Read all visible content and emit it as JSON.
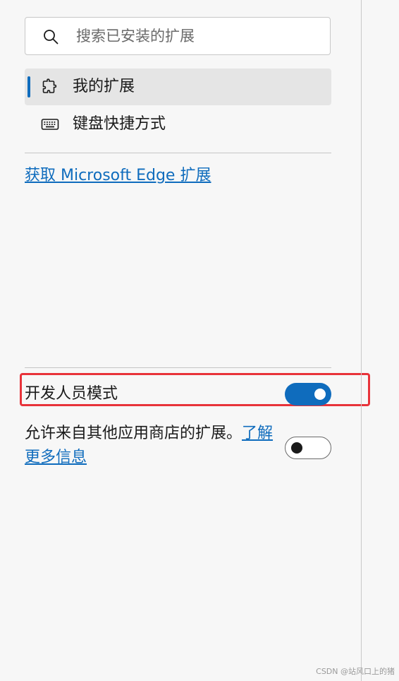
{
  "search": {
    "placeholder": "搜索已安装的扩展",
    "icon": "search-icon"
  },
  "nav": {
    "items": [
      {
        "label": "我的扩展",
        "icon": "puzzle-icon",
        "selected": true
      },
      {
        "label": "键盘快捷方式",
        "icon": "keyboard-icon",
        "selected": false
      }
    ]
  },
  "get_extensions_link": "获取 Microsoft Edge 扩展",
  "settings": {
    "developer_mode": {
      "label": "开发人员模式",
      "on": true
    },
    "allow_other_stores": {
      "label": "允许来自其他应用商店的扩展。",
      "learn_more": "了解更多信息",
      "on": false
    }
  },
  "watermark": "CSDN @站风口上的猪",
  "colors": {
    "accent": "#0f6cbd",
    "highlight": "#e8333a",
    "selected_bg": "#e5e5e5",
    "page_bg": "#f7f7f7"
  }
}
